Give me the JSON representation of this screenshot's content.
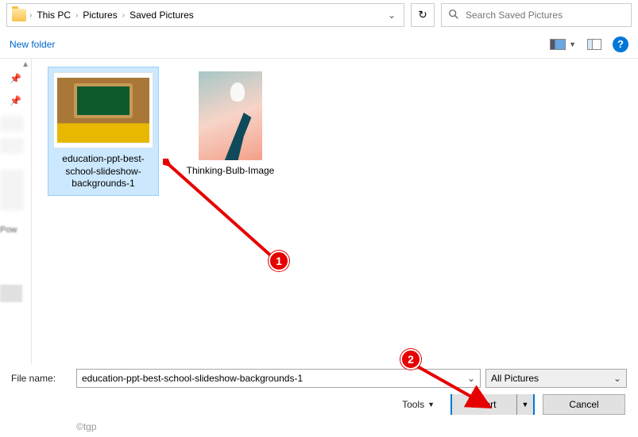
{
  "breadcrumbs": {
    "pc": "This PC",
    "pictures": "Pictures",
    "saved": "Saved Pictures"
  },
  "search": {
    "placeholder": "Search Saved Pictures"
  },
  "toolbar": {
    "new_folder": "New folder"
  },
  "nav": {
    "pow": "Pow"
  },
  "files": {
    "item0": {
      "name": "education-ppt-best-school-slideshow-backgrounds-1"
    },
    "item1": {
      "name": "Thinking-Bulb-Image"
    }
  },
  "bottom": {
    "filename_label": "File name:",
    "filename_value": "education-ppt-best-school-slideshow-backgrounds-1",
    "filter": "All Pictures",
    "tools": "Tools",
    "insert": "Insert",
    "cancel": "Cancel"
  },
  "callouts": {
    "c1": "1",
    "c2": "2"
  },
  "watermark": "©tgp"
}
